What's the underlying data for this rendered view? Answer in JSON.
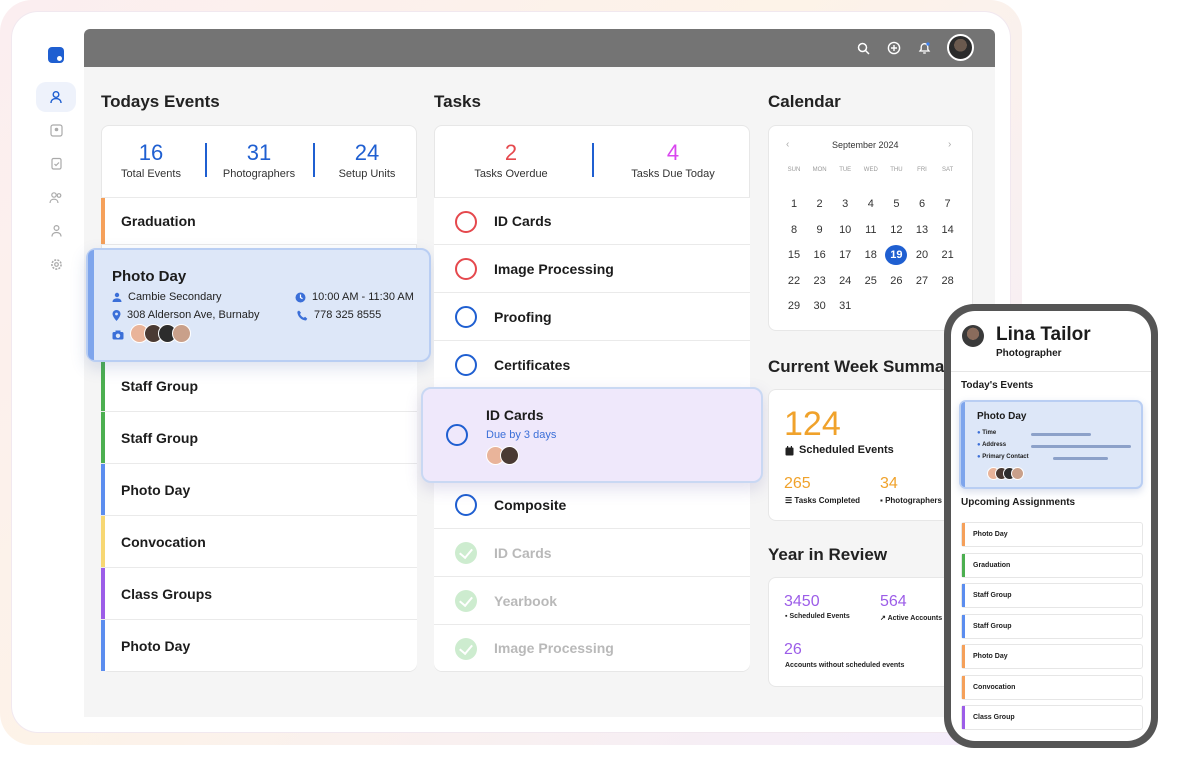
{
  "sidebar": {
    "icons": [
      "app-logo-icon",
      "user-icon",
      "contacts-icon",
      "clipboard-icon",
      "users-icon",
      "person-icon",
      "settings-icon"
    ]
  },
  "topbar": {
    "icons": [
      "search-icon",
      "add-icon",
      "bell-icon"
    ],
    "avatar": "user-avatar"
  },
  "today_events": {
    "title": "Todays Events",
    "stats": [
      {
        "value": "16",
        "label": "Total Events"
      },
      {
        "value": "31",
        "label": "Photographers"
      },
      {
        "value": "24",
        "label": "Setup Units"
      }
    ],
    "items": [
      {
        "label": "Graduation",
        "color": "#f5a05a"
      },
      {
        "label": "Staff Group",
        "color": "#4caf50"
      },
      {
        "label": "Staff Group",
        "color": "#4caf50"
      },
      {
        "label": "Photo Day",
        "color": "#5b8def"
      },
      {
        "label": "Convocation",
        "color": "#f7d773"
      },
      {
        "label": "Class Groups",
        "color": "#9c5de8"
      },
      {
        "label": "Photo Day",
        "color": "#5b8def"
      }
    ],
    "popup": {
      "title": "Photo Day",
      "location": "Cambie Secondary",
      "address": "308 Alderson Ave, Burnaby",
      "time": "10:00 AM - 11:30 AM",
      "phone": "778 325 8555"
    }
  },
  "tasks": {
    "title": "Tasks",
    "overdue": {
      "value": "2",
      "label": "Tasks Overdue",
      "color": "#e5484d"
    },
    "due_today": {
      "value": "4",
      "label": "Tasks Due Today",
      "color": "#d946ef"
    },
    "items": [
      {
        "label": "ID Cards",
        "state": "overdue"
      },
      {
        "label": "Image Processing",
        "state": "overdue"
      },
      {
        "label": "Proofing",
        "state": "open"
      },
      {
        "label": "Certificates",
        "state": "open"
      },
      {
        "label": "Composite",
        "state": "open"
      },
      {
        "label": "ID Cards",
        "state": "done"
      },
      {
        "label": "Yearbook",
        "state": "done"
      },
      {
        "label": "Image Processing",
        "state": "done"
      }
    ],
    "popup": {
      "title": "ID Cards",
      "due": "Due by 3 days"
    }
  },
  "calendar": {
    "title": "Calendar",
    "month": "September 2024",
    "dow": [
      "SUN",
      "MON",
      "TUE",
      "WED",
      "THU",
      "FRI",
      "SAT"
    ],
    "weeks": [
      [
        "1",
        "2",
        "3",
        "4",
        "5",
        "6",
        "7"
      ],
      [
        "8",
        "9",
        "10",
        "11",
        "12",
        "13",
        "14"
      ],
      [
        "15",
        "16",
        "17",
        "18",
        "19",
        "20",
        "21"
      ],
      [
        "22",
        "23",
        "24",
        "25",
        "26",
        "27",
        "28"
      ],
      [
        "29",
        "30",
        "31"
      ]
    ],
    "today": "19"
  },
  "week": {
    "title": "Current Week Summary",
    "scheduled": "124",
    "scheduled_label": "Scheduled Events",
    "tasks_completed": "265",
    "tasks_label": "Tasks Completed",
    "photographers": "34",
    "photographers_label": "Photographers"
  },
  "year": {
    "title": "Year in Review",
    "scheduled": "3450",
    "scheduled_label": "Scheduled Events",
    "active": "564",
    "active_label": "Active Accounts",
    "without": "26",
    "without_label": "Accounts without scheduled events"
  },
  "phone": {
    "name": "Lina Tailor",
    "role": "Photographer",
    "today_label": "Today's Events",
    "event": {
      "title": "Photo Day",
      "fields": [
        "Time",
        "Address",
        "Primary Contact"
      ]
    },
    "upcoming_label": "Upcoming Assignments",
    "upcoming": [
      {
        "label": "Photo Day",
        "color": "#f5a05a"
      },
      {
        "label": "Graduation",
        "color": "#4caf50"
      },
      {
        "label": "Staff Group",
        "color": "#5b8def"
      },
      {
        "label": "Staff Group",
        "color": "#5b8def"
      },
      {
        "label": "Photo Day",
        "color": "#f5a05a"
      },
      {
        "label": "Convocation",
        "color": "#f5a05a"
      },
      {
        "label": "Class Group",
        "color": "#9c5de8"
      }
    ]
  }
}
